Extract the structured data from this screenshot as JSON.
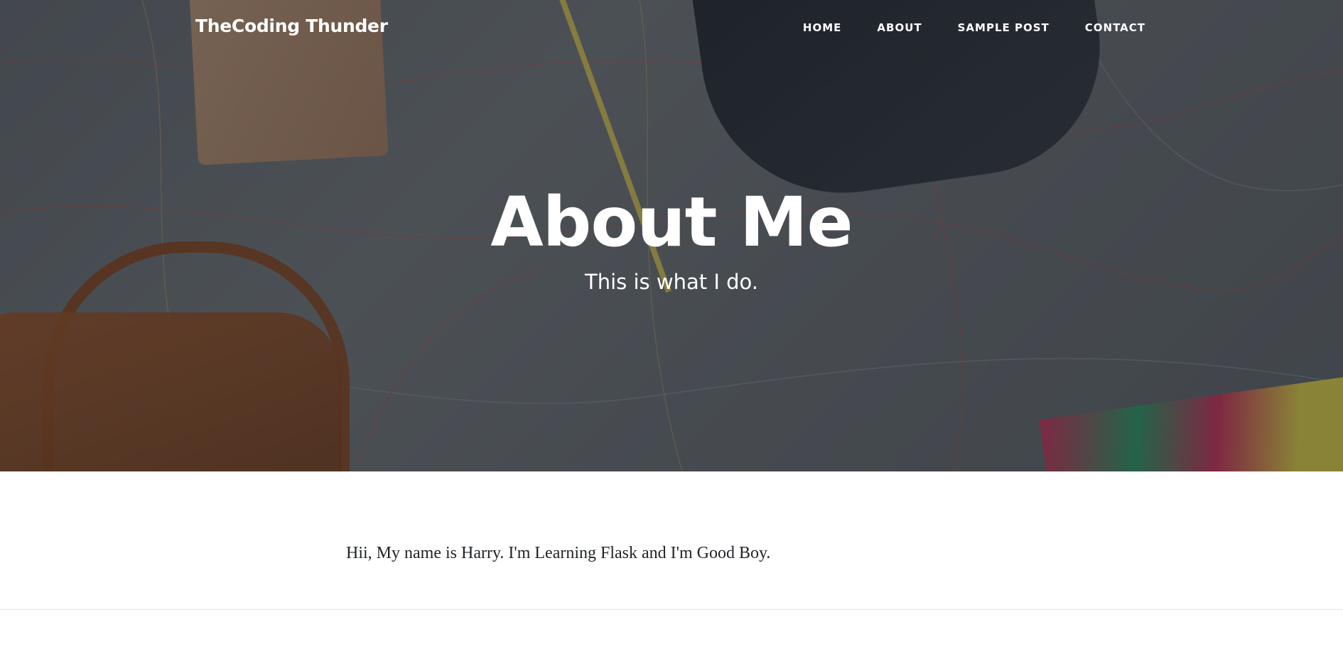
{
  "navbar": {
    "brand": "TheCoding Thunder",
    "links": [
      {
        "label": "HOME"
      },
      {
        "label": "ABOUT"
      },
      {
        "label": "SAMPLE POST"
      },
      {
        "label": "CONTACT"
      }
    ]
  },
  "masthead": {
    "heading": "About Me",
    "subheading": "This is what I do."
  },
  "content": {
    "paragraph": "Hii, My name is Harry. I'm Learning Flask and I'm Good Boy."
  }
}
